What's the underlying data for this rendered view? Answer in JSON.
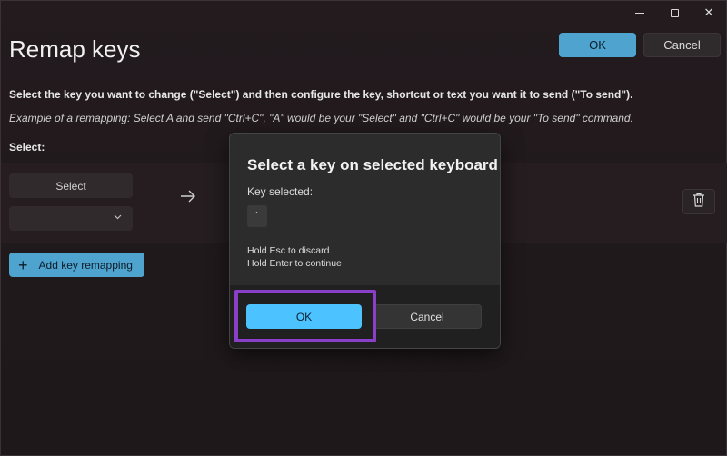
{
  "window": {
    "controls": {
      "minimize": "",
      "maximize": "",
      "close": "✕"
    }
  },
  "header": {
    "title": "Remap keys",
    "ok_label": "OK",
    "cancel_label": "Cancel"
  },
  "main": {
    "instruction": "Select the key you want to change (\"Select\") and then configure the key, shortcut or text you want it to send (\"To send\").",
    "example": "Example of a remapping: Select A and send \"Ctrl+C\", \"A\" would be your \"Select\" and \"Ctrl+C\" would be your \"To send\" command.",
    "select_header": "Select:",
    "select_button": "Select",
    "dropdown_value": "",
    "add_button": "Add key remapping"
  },
  "dialog": {
    "title": "Select a key on selected keyboard",
    "key_selected_label": "Key selected:",
    "key_value": "`",
    "hint_discard": "Hold Esc to discard",
    "hint_continue": "Hold Enter to continue",
    "ok_label": "OK",
    "cancel_label": "Cancel"
  },
  "colors": {
    "accent": "#4cc2ff",
    "highlight": "#8a3fc9"
  },
  "icons": [
    "minimize-icon",
    "maximize-icon",
    "close-icon",
    "chevron-down-icon",
    "arrow-right-icon",
    "trash-icon",
    "plus-icon"
  ]
}
